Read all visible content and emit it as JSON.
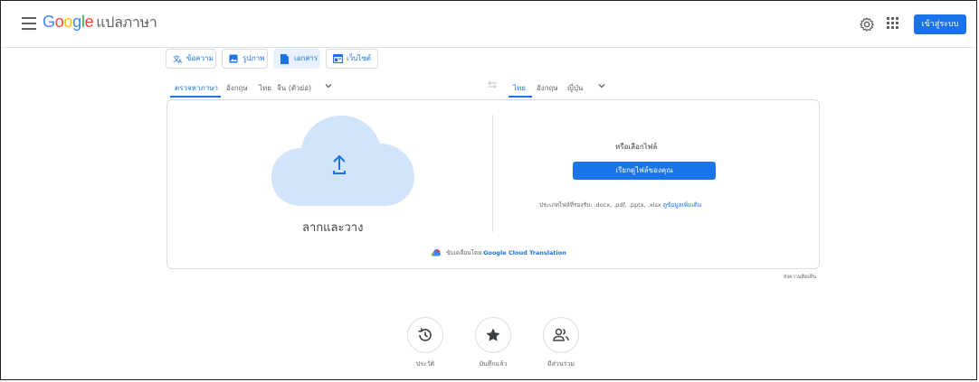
{
  "header": {
    "logo_parts": [
      "G",
      "o",
      "o",
      "g",
      "l",
      "e"
    ],
    "product": "แปลภาษา",
    "signin_label": "เข้าสู่ระบบ"
  },
  "modes": [
    {
      "label": "ข้อความ"
    },
    {
      "label": "รูปภาพ"
    },
    {
      "label": "เอกสาร"
    },
    {
      "label": "เว็บไซต์"
    }
  ],
  "source_langs": [
    "ตรวจหาภาษา",
    "อังกฤษ",
    "ไทย",
    "จีน (ตัวย่อ)"
  ],
  "target_langs": [
    "ไทย",
    "อังกฤษ",
    "ญี่ปุ่น"
  ],
  "upload": {
    "drag_text": "ลากและวาง",
    "or_choose": "หรือเลือกไฟล์",
    "browse_label": "เรียกดูไฟล์ของคุณ",
    "supported_types": "ประเภทไฟล์ที่รองรับ: .docx, .pdf, .pptx, .xlsx",
    "learn_more": "ดูข้อมูลเพิ่มเติม"
  },
  "powered_by": {
    "prefix": "ขับเคลื่อนโดย",
    "name": "Google Cloud Translation"
  },
  "feedback": "ส่งความคิดเห็น",
  "bottom_actions": [
    {
      "label": "ประวัติ",
      "icon": "history-icon"
    },
    {
      "label": "บันทึกแล้ว",
      "icon": "star-icon"
    },
    {
      "label": "มีส่วนร่วม",
      "icon": "people-icon"
    }
  ],
  "colors": {
    "accent": "#1a73e8",
    "cloud": "#d2e3fc"
  }
}
